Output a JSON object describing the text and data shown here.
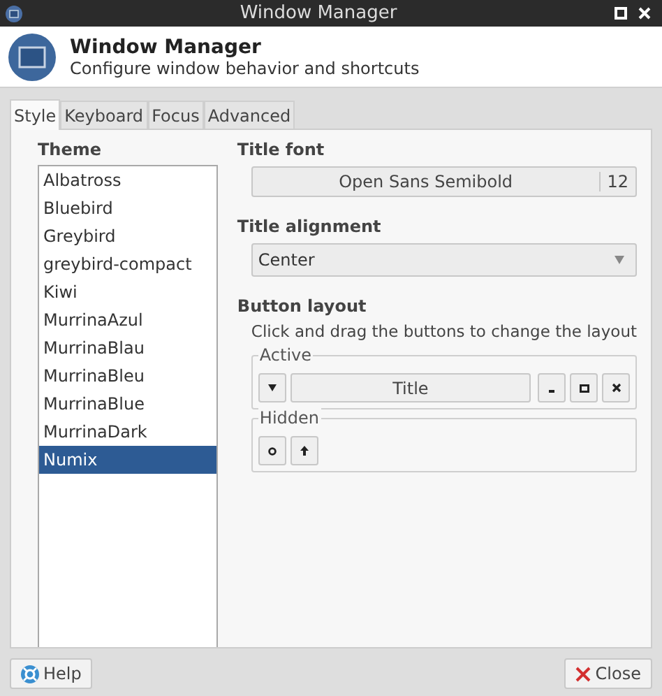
{
  "window": {
    "title": "Window Manager"
  },
  "header": {
    "title": "Window Manager",
    "subtitle": "Configure window behavior and shortcuts"
  },
  "tabs": [
    {
      "label": "Style",
      "selected": true
    },
    {
      "label": "Keyboard",
      "selected": false
    },
    {
      "label": "Focus",
      "selected": false
    },
    {
      "label": "Advanced",
      "selected": false
    }
  ],
  "theme": {
    "label": "Theme",
    "items": [
      {
        "label": "Albatross",
        "selected": false
      },
      {
        "label": "Bluebird",
        "selected": false
      },
      {
        "label": "Greybird",
        "selected": false
      },
      {
        "label": "greybird-compact",
        "selected": false
      },
      {
        "label": "Kiwi",
        "selected": false
      },
      {
        "label": "MurrinaAzul",
        "selected": false
      },
      {
        "label": "MurrinaBlau",
        "selected": false
      },
      {
        "label": "MurrinaBleu",
        "selected": false
      },
      {
        "label": "MurrinaBlue",
        "selected": false
      },
      {
        "label": "MurrinaDark",
        "selected": false
      },
      {
        "label": "Numix",
        "selected": true
      }
    ]
  },
  "title_font": {
    "label": "Title font",
    "font": "Open Sans Semibold",
    "size": "12"
  },
  "title_alignment": {
    "label": "Title alignment",
    "value": "Center"
  },
  "button_layout": {
    "label": "Button layout",
    "hint": "Click and drag the buttons to change the layout",
    "active": {
      "label": "Active",
      "buttons": [
        {
          "kind": "menu"
        },
        {
          "kind": "title",
          "label": "Title"
        },
        {
          "kind": "minimize"
        },
        {
          "kind": "maximize"
        },
        {
          "kind": "close"
        }
      ]
    },
    "hidden": {
      "label": "Hidden",
      "buttons": [
        {
          "kind": "shade"
        },
        {
          "kind": "stick"
        }
      ]
    }
  },
  "buttons": [
    {
      "kind": "help",
      "label": "Help"
    },
    {
      "kind": "close",
      "label": "Close"
    }
  ]
}
